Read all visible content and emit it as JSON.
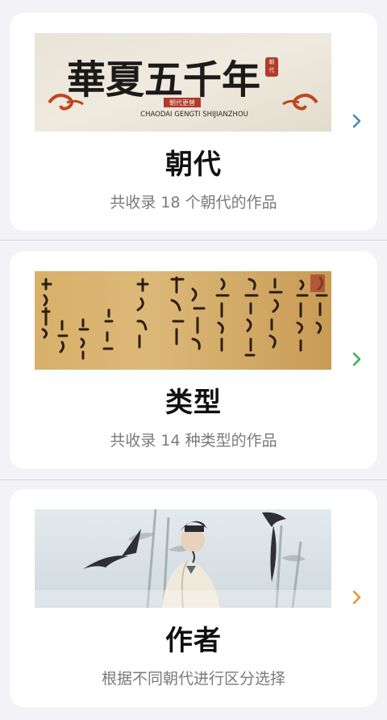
{
  "categories": [
    {
      "key": "dynasty",
      "title": "朝代",
      "subtitle": "共收录 18 个朝代的作品",
      "chevron_color": "#4a86b5",
      "banner": {
        "calligraphy": "華夏五千年",
        "seal": "朝代",
        "small_label": "朝代更替",
        "pinyin": "CHAODAI GENGTI SHIJIANZHOU"
      }
    },
    {
      "key": "type",
      "title": "类型",
      "subtitle": "共收录 14 种类型的作品",
      "chevron_color": "#3fae5a"
    },
    {
      "key": "author",
      "title": "作者",
      "subtitle": "根据不同朝代进行区分选择",
      "chevron_color": "#e5962a"
    }
  ]
}
